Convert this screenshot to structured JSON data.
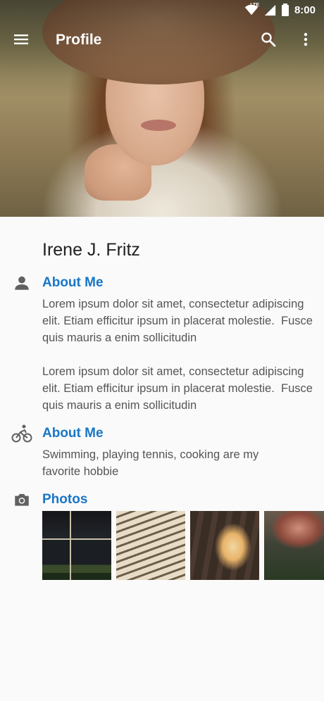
{
  "status_bar": {
    "network": "LTE",
    "time": "8:00"
  },
  "app_bar": {
    "title": "Profile",
    "menu_icon": "hamburger-menu-icon",
    "search_icon": "search-icon",
    "more_icon": "more-vert-icon"
  },
  "profile": {
    "name": "Irene J. Fritz"
  },
  "sections": [
    {
      "icon": "person-icon",
      "title": "About Me",
      "text": "Lorem ipsum dolor sit amet, consectetur adipiscing elit. Etiam efficitur ipsum in placerat molestie.  Fusce quis mauris a enim sollicitudin\n\nLorem ipsum dolor sit amet, consectetur adipiscing elit. Etiam efficitur ipsum in placerat molestie.  Fusce quis mauris a enim sollicitudin"
    },
    {
      "icon": "bicycle-icon",
      "title": "About Me",
      "text": "Swimming, playing tennis, cooking are my favorite hobbie"
    },
    {
      "icon": "camera-icon",
      "title": "Photos"
    }
  ],
  "photos": [
    {
      "name": "window-photo"
    },
    {
      "name": "bench-photo"
    },
    {
      "name": "drink-photo"
    },
    {
      "name": "terrace-photo"
    }
  ],
  "colors": {
    "accent": "#1976c7",
    "background": "#fafafa",
    "name_text": "#212121",
    "body_text": "#555555",
    "icon": "#616161"
  }
}
